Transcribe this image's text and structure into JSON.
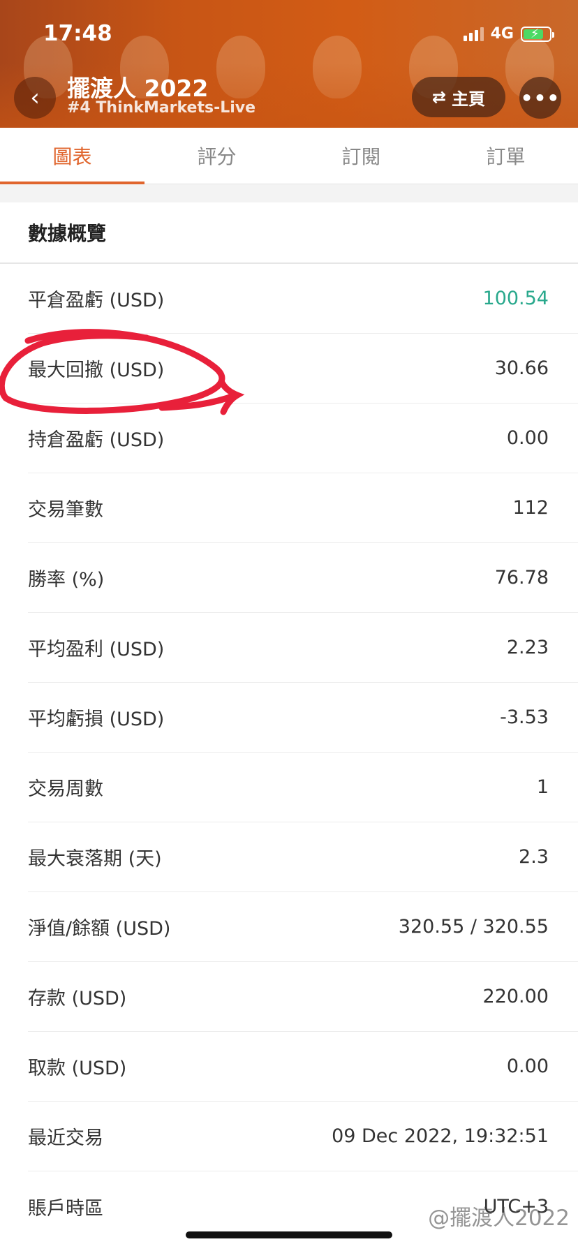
{
  "status_bar": {
    "time": "17:48",
    "network": "4G"
  },
  "header": {
    "title": "擺渡人 2022",
    "subtitle": "#4 ThinkMarkets-Live",
    "home_label": "主頁",
    "more_label": "•••"
  },
  "tabs": [
    {
      "label": "圖表",
      "active": true
    },
    {
      "label": "評分",
      "active": false
    },
    {
      "label": "訂閱",
      "active": false
    },
    {
      "label": "訂單",
      "active": false
    }
  ],
  "section": {
    "title": "數據概覽"
  },
  "stats": [
    {
      "label": "平倉盈虧 (USD)",
      "value": "100.54"
    },
    {
      "label": "最大回撤 (USD)",
      "value": "30.66"
    },
    {
      "label": "持倉盈虧 (USD)",
      "value": "0.00"
    },
    {
      "label": "交易筆數",
      "value": "112"
    },
    {
      "label": "勝率 (%)",
      "value": "76.78"
    },
    {
      "label": "平均盈利 (USD)",
      "value": "2.23"
    },
    {
      "label": "平均虧損 (USD)",
      "value": "-3.53"
    },
    {
      "label": "交易周數",
      "value": "1"
    },
    {
      "label": "最大衰落期 (天)",
      "value": "2.3"
    },
    {
      "label": "淨值/餘額 (USD)",
      "value": "320.55 / 320.55"
    },
    {
      "label": "存款 (USD)",
      "value": "220.00"
    },
    {
      "label": "取款 (USD)",
      "value": "0.00"
    },
    {
      "label": "最近交易",
      "value": "09 Dec 2022, 19:32:51"
    },
    {
      "label": "賬戶時區",
      "value": "UTC+3"
    }
  ],
  "watermark": "@擺渡人2022",
  "colors": {
    "accent": "#e0652d",
    "positive": "#28a88c",
    "annotation": "#e8203a"
  },
  "icons": [
    "signal-icon",
    "battery-icon",
    "back-icon",
    "swap-icon",
    "more-icon"
  ]
}
